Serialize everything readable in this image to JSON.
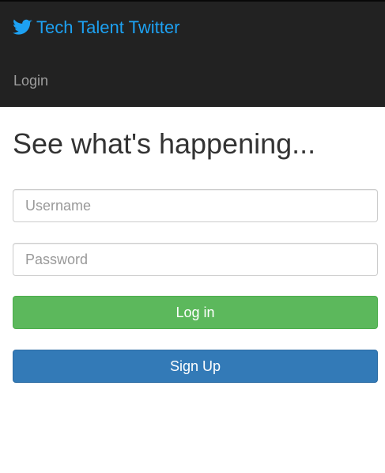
{
  "navbar": {
    "brand_icon": "twitter-bird-icon",
    "brand_text": "Tech Talent Twitter",
    "login_link": "Login",
    "colors": {
      "background": "#222222",
      "brand": "#1da1f2",
      "link": "#9d9d9d"
    }
  },
  "main": {
    "headline": "See what's happening...",
    "username_placeholder": "Username",
    "username_value": "",
    "password_placeholder": "Password",
    "password_value": "",
    "login_button": "Log in",
    "signup_button": "Sign Up",
    "colors": {
      "login_button": "#5cb85c",
      "signup_button": "#337ab7",
      "headline": "#333333"
    }
  }
}
